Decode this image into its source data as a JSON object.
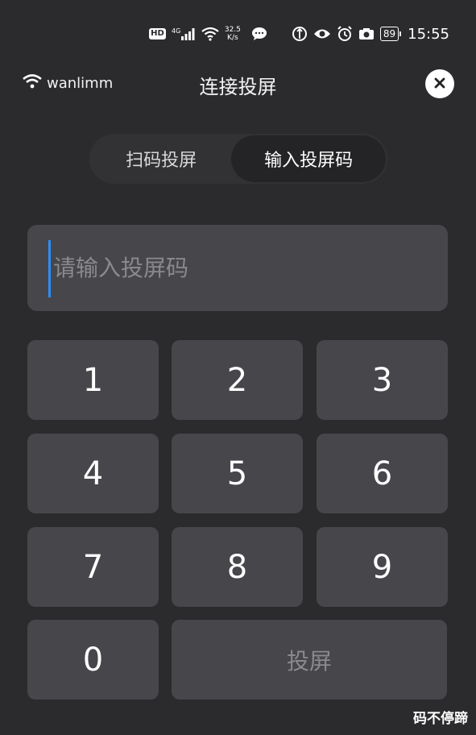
{
  "status_bar": {
    "hd": "HD",
    "signal": "4G",
    "net_speed_value": "32.5",
    "net_speed_unit": "K/s",
    "battery": "89",
    "time": "15:55"
  },
  "header": {
    "wifi_name": "wanlimm",
    "title": "连接投屏"
  },
  "tabs": [
    {
      "label": "扫码投屏",
      "active": false
    },
    {
      "label": "输入投屏码",
      "active": true
    }
  ],
  "code_input": {
    "placeholder": "请输入投屏码",
    "value": ""
  },
  "keypad": {
    "keys": [
      "1",
      "2",
      "3",
      "4",
      "5",
      "6",
      "7",
      "8",
      "9",
      "0"
    ],
    "cast_label": "投屏"
  },
  "watermark": "码不停蹄",
  "colors": {
    "background": "#2b2b2e",
    "key": "#47474b",
    "caret": "#2f8ef5",
    "placeholder": "#8a8a8d"
  }
}
